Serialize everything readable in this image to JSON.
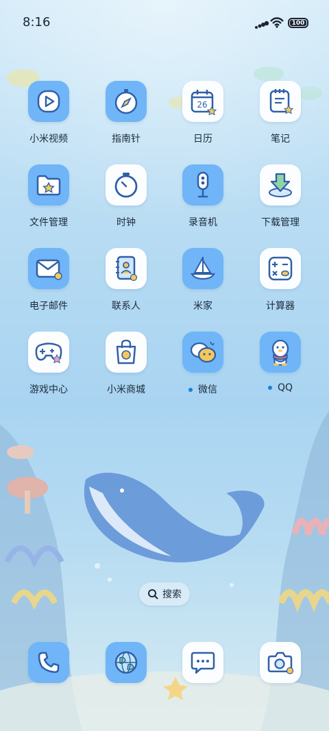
{
  "status_bar": {
    "time": "8:16",
    "battery": "100"
  },
  "apps": [
    {
      "label": "小米视频",
      "icon": "play-icon"
    },
    {
      "label": "指南针",
      "icon": "compass-icon"
    },
    {
      "label": "日历",
      "icon": "calendar-icon",
      "date": "26"
    },
    {
      "label": "笔记",
      "icon": "notes-icon"
    },
    {
      "label": "文件管理",
      "icon": "folder-icon"
    },
    {
      "label": "时钟",
      "icon": "clock-icon"
    },
    {
      "label": "录音机",
      "icon": "microphone-icon"
    },
    {
      "label": "下载管理",
      "icon": "download-icon"
    },
    {
      "label": "电子邮件",
      "icon": "mail-icon"
    },
    {
      "label": "联系人",
      "icon": "contacts-icon"
    },
    {
      "label": "米家",
      "icon": "sailboat-icon"
    },
    {
      "label": "计算器",
      "icon": "calculator-icon"
    },
    {
      "label": "游戏中心",
      "icon": "gamepad-icon"
    },
    {
      "label": "小米商城",
      "icon": "shopping-bag-icon"
    },
    {
      "label": "微信",
      "icon": "wechat-icon"
    },
    {
      "label": "QQ",
      "icon": "qq-penguin-icon"
    }
  ],
  "search": {
    "label": "搜索"
  },
  "dock": [
    {
      "icon": "phone-icon"
    },
    {
      "icon": "browser-globe-icon"
    },
    {
      "icon": "messages-icon"
    },
    {
      "icon": "camera-icon"
    }
  ],
  "colors": {
    "icon_blue": "#6fb5f7",
    "icon_white": "#fbfdff",
    "accent": "#1e7fd6",
    "text": "#1b2a3a"
  }
}
